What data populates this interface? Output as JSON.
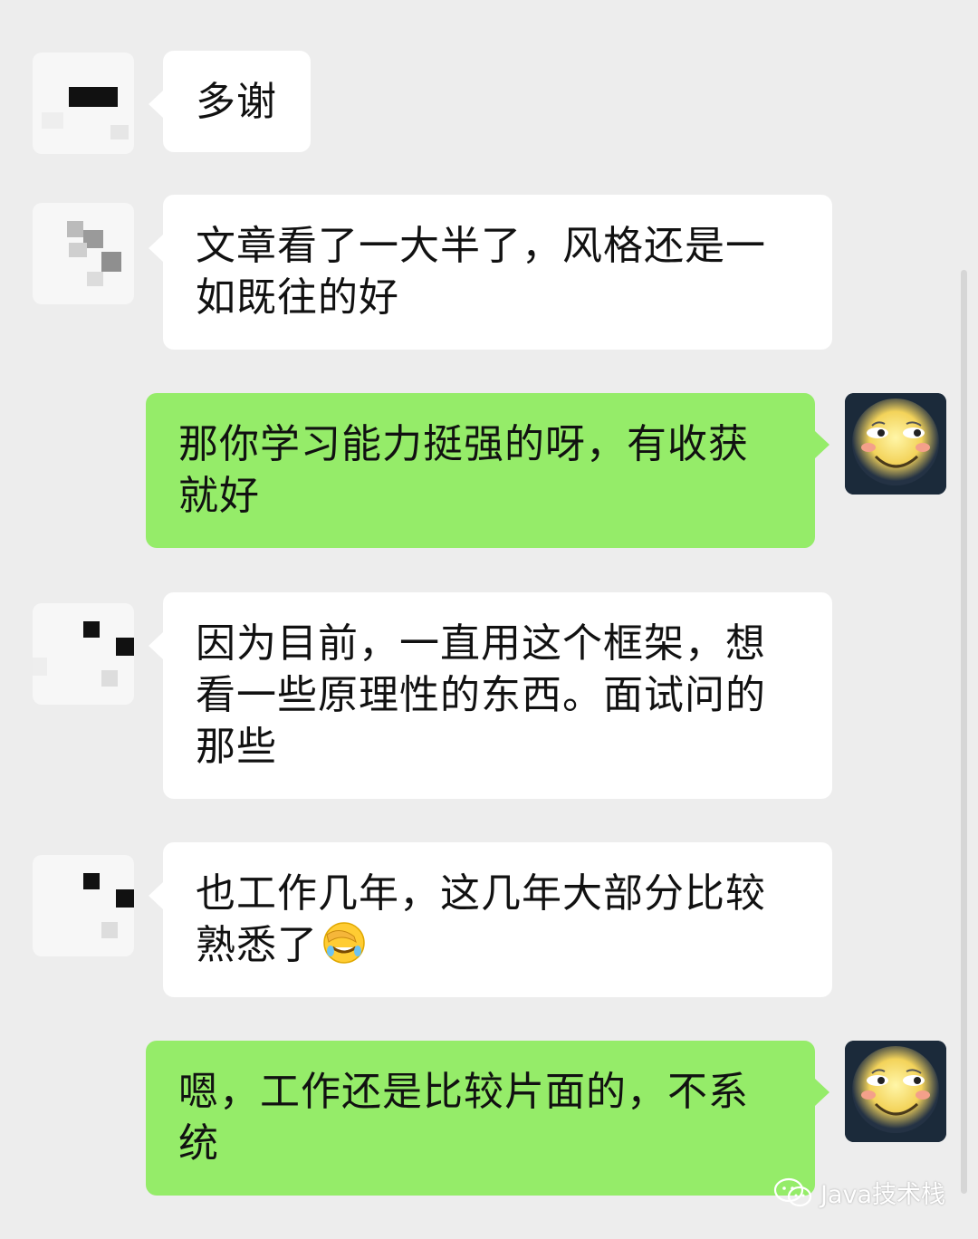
{
  "chat": {
    "messages": [
      {
        "text": "多谢"
      },
      {
        "text": "文章看了一大半了，风格还是一如既往的好"
      },
      {
        "text": "那你学习能力挺强的呀，有收获就好"
      },
      {
        "text": "因为目前，一直用这个框架，想看一些原理性的东西。面试问的那些"
      },
      {
        "text": "也工作几年，这几年大部分比较熟悉了",
        "emoji": "facepalm-emoji"
      },
      {
        "text": "嗯，工作还是比较片面的，不系统"
      }
    ]
  },
  "watermark": {
    "label": "Java技术栈",
    "icon": "wechat-icon"
  },
  "colors": {
    "background": "#ededed",
    "incoming_bubble": "#ffffff",
    "outgoing_bubble": "#95ec69"
  }
}
